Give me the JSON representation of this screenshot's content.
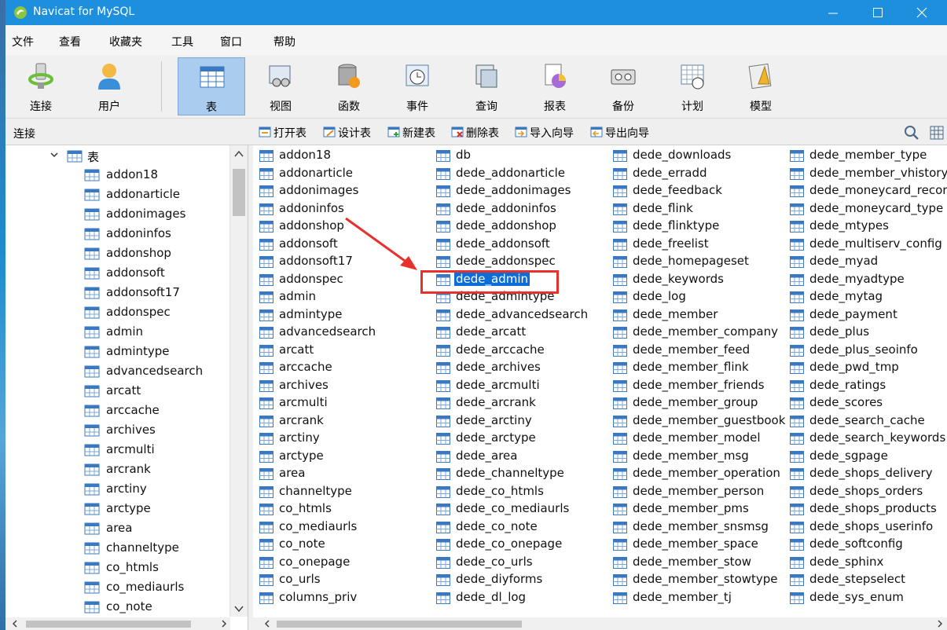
{
  "window": {
    "title": "Navicat for MySQL"
  },
  "menu": [
    "文件",
    "查看",
    "收藏夹",
    "工具",
    "窗口",
    "帮助"
  ],
  "toolbar": [
    {
      "label": "连接",
      "icon": "connection-icon"
    },
    {
      "label": "用户",
      "icon": "user-icon"
    },
    {
      "label": "表",
      "icon": "table-icon",
      "active": true
    },
    {
      "label": "视图",
      "icon": "view-icon"
    },
    {
      "label": "函数",
      "icon": "function-icon"
    },
    {
      "label": "事件",
      "icon": "event-icon"
    },
    {
      "label": "查询",
      "icon": "query-icon"
    },
    {
      "label": "报表",
      "icon": "report-icon"
    },
    {
      "label": "备份",
      "icon": "backup-icon"
    },
    {
      "label": "计划",
      "icon": "schedule-icon"
    },
    {
      "label": "模型",
      "icon": "model-icon"
    }
  ],
  "objbar": {
    "connection_label": "连接",
    "buttons": [
      "打开表",
      "设计表",
      "新建表",
      "删除表",
      "导入向导",
      "导出向导"
    ]
  },
  "tree": {
    "root_label": "表",
    "items": [
      "addon18",
      "addonarticle",
      "addonimages",
      "addoninfos",
      "addonshop",
      "addonsoft",
      "addonsoft17",
      "addonspec",
      "admin",
      "admintype",
      "advancedsearch",
      "arcatt",
      "arccache",
      "archives",
      "arcmulti",
      "arcrank",
      "arctiny",
      "arctype",
      "area",
      "channeltype",
      "co_htmls",
      "co_mediaurls",
      "co_note"
    ]
  },
  "tables": {
    "selected": "dede_admin",
    "columns": [
      [
        "addon18",
        "addonarticle",
        "addonimages",
        "addoninfos",
        "addonshop",
        "addonsoft",
        "addonsoft17",
        "addonspec",
        "admin",
        "admintype",
        "advancedsearch",
        "arcatt",
        "arccache",
        "archives",
        "arcmulti",
        "arcrank",
        "arctiny",
        "arctype",
        "area",
        "channeltype",
        "co_htmls",
        "co_mediaurls",
        "co_note",
        "co_onepage",
        "co_urls",
        "columns_priv"
      ],
      [
        "db",
        "dede_addonarticle",
        "dede_addonimages",
        "dede_addoninfos",
        "dede_addonshop",
        "dede_addonsoft",
        "dede_addonspec",
        "dede_admin",
        "dede_admintype",
        "dede_advancedsearch",
        "dede_arcatt",
        "dede_arccache",
        "dede_archives",
        "dede_arcmulti",
        "dede_arcrank",
        "dede_arctiny",
        "dede_arctype",
        "dede_area",
        "dede_channeltype",
        "dede_co_htmls",
        "dede_co_mediaurls",
        "dede_co_note",
        "dede_co_onepage",
        "dede_co_urls",
        "dede_diyforms",
        "dede_dl_log"
      ],
      [
        "dede_downloads",
        "dede_erradd",
        "dede_feedback",
        "dede_flink",
        "dede_flinktype",
        "dede_freelist",
        "dede_homepageset",
        "dede_keywords",
        "dede_log",
        "dede_member",
        "dede_member_company",
        "dede_member_feed",
        "dede_member_flink",
        "dede_member_friends",
        "dede_member_group",
        "dede_member_guestbook",
        "dede_member_model",
        "dede_member_msg",
        "dede_member_operation",
        "dede_member_person",
        "dede_member_pms",
        "dede_member_snsmsg",
        "dede_member_space",
        "dede_member_stow",
        "dede_member_stowtype",
        "dede_member_tj"
      ],
      [
        "dede_member_type",
        "dede_member_vhistory",
        "dede_moneycard_record",
        "dede_moneycard_type",
        "dede_mtypes",
        "dede_multiserv_config",
        "dede_myad",
        "dede_myadtype",
        "dede_mytag",
        "dede_payment",
        "dede_plus",
        "dede_plus_seoinfo",
        "dede_pwd_tmp",
        "dede_ratings",
        "dede_scores",
        "dede_search_cache",
        "dede_search_keywords",
        "dede_sgpage",
        "dede_shops_delivery",
        "dede_shops_orders",
        "dede_shops_products",
        "dede_shops_userinfo",
        "dede_softconfig",
        "dede_sphinx",
        "dede_stepselect",
        "dede_sys_enum"
      ]
    ]
  },
  "colors": {
    "titlebar": "#1d8fdc",
    "active_tool": "#aaccee",
    "selection": "#0b6ed8",
    "annotation": "#e8302c"
  }
}
